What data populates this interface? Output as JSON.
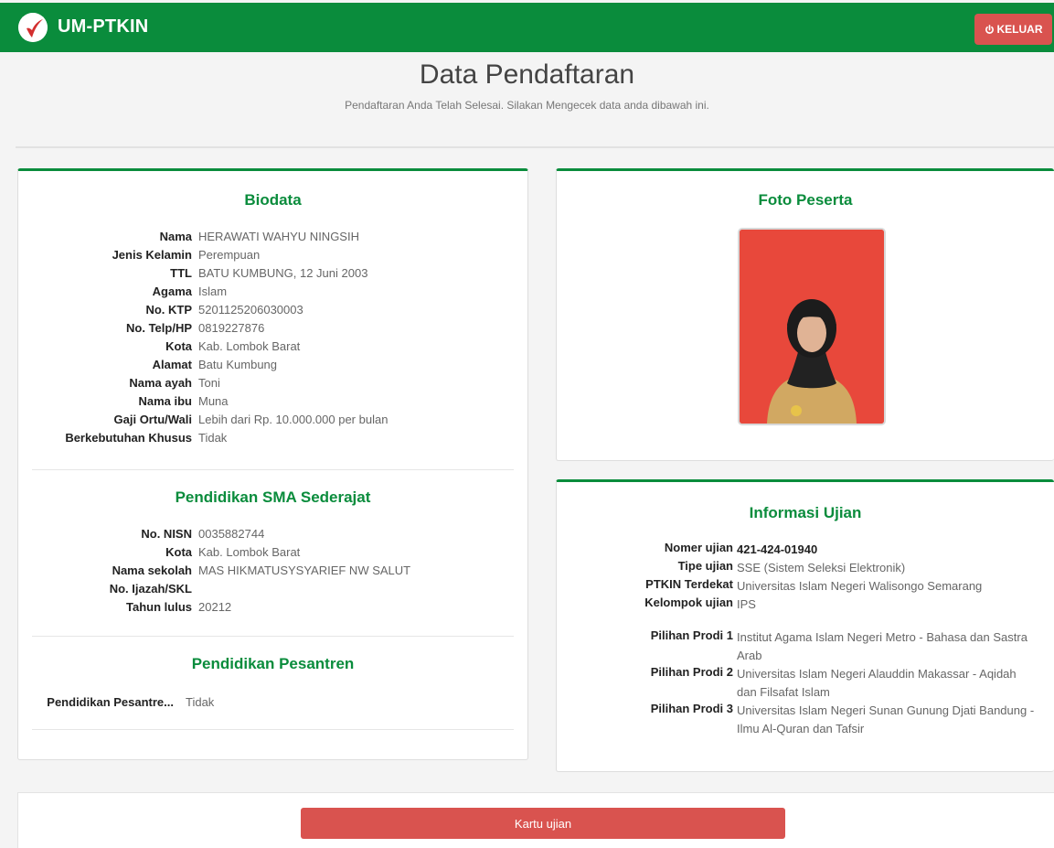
{
  "header": {
    "brand": "UM-PTKIN",
    "logout_label": "KELUAR",
    "colors": {
      "primary": "#0a8c3c",
      "danger": "#d9534f"
    },
    "logout_icon": "power-icon"
  },
  "page": {
    "title": "Data Pendaftaran",
    "subtitle": "Pendaftaran Anda Telah Selesai. Silakan Mengecek data anda dibawah ini."
  },
  "biodata": {
    "title": "Biodata",
    "rows": [
      {
        "label": "Nama",
        "value": "HERAWATI WAHYU NINGSIH"
      },
      {
        "label": "Jenis Kelamin",
        "value": "Perempuan"
      },
      {
        "label": "TTL",
        "value": "BATU KUMBUNG, 12 Juni 2003"
      },
      {
        "label": "Agama",
        "value": "Islam"
      },
      {
        "label": "No. KTP",
        "value": "5201125206030003"
      },
      {
        "label": "No. Telp/HP",
        "value": "0819227876"
      },
      {
        "label": "Kota",
        "value": "Kab. Lombok Barat"
      },
      {
        "label": "Alamat",
        "value": "Batu Kumbung"
      },
      {
        "label": "Nama ayah",
        "value": "Toni"
      },
      {
        "label": "Nama ibu",
        "value": "Muna"
      },
      {
        "label": "Gaji Ortu/Wali",
        "value": "Lebih dari Rp. 10.000.000 per bulan"
      },
      {
        "label": "Berkebutuhan Khusus",
        "value": "Tidak"
      }
    ]
  },
  "sma": {
    "title": "Pendidikan SMA Sederajat",
    "rows": [
      {
        "label": "No. NISN",
        "value": "0035882744"
      },
      {
        "label": "Kota",
        "value": "Kab. Lombok Barat"
      },
      {
        "label": "Nama sekolah",
        "value": "MAS HIKMATUSYSYARIEF NW SALUT"
      },
      {
        "label": "No. Ijazah/SKL",
        "value": ""
      },
      {
        "label": "Tahun lulus",
        "value": "20212"
      }
    ]
  },
  "pesantren": {
    "title": "Pendidikan Pesantren",
    "rows": [
      {
        "label": "Pendidikan Pesantre...",
        "value": "Tidak"
      }
    ]
  },
  "foto": {
    "title": "Foto Peserta"
  },
  "ujian": {
    "title": "Informasi Ujian",
    "rows": [
      {
        "label": "Nomer ujian",
        "value": "421-424-01940"
      },
      {
        "label": "Tipe ujian",
        "value": "SSE (Sistem Seleksi Elektronik)"
      },
      {
        "label": "PTKIN Terdekat",
        "value": "Universitas Islam Negeri Walisongo Semarang"
      },
      {
        "label": "Kelompok ujian",
        "value": "IPS"
      }
    ],
    "prodi": [
      {
        "label": "Pilihan Prodi 1",
        "value": "Institut Agama Islam Negeri Metro - Bahasa dan Sastra Arab"
      },
      {
        "label": "Pilihan Prodi 2",
        "value": "Universitas Islam Negeri Alauddin Makassar - Aqidah dan Filsafat Islam"
      },
      {
        "label": "Pilihan Prodi 3",
        "value": "Universitas Islam Negeri Sunan Gunung Djati Bandung - Ilmu Al-Quran dan Tafsir"
      }
    ]
  },
  "actions": {
    "kartu_label": "Kartu ujian"
  }
}
